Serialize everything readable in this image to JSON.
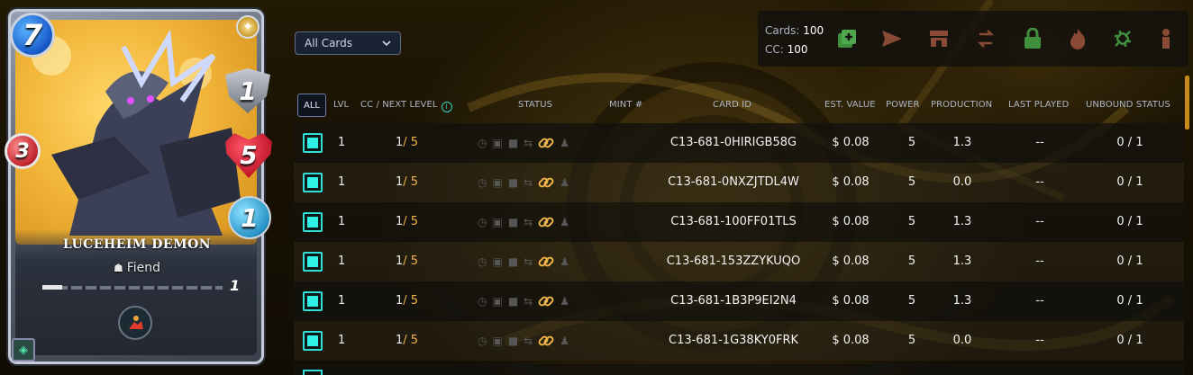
{
  "card": {
    "name": "LUCEHEIM DEMON",
    "type": "Fiend",
    "mana": "7",
    "armor": "1",
    "health": "5",
    "speed": "1",
    "melee": "3",
    "level": "1"
  },
  "filter": {
    "selected": "All Cards"
  },
  "toolbar": {
    "cards_label": "Cards:",
    "cards_value": "100",
    "cc_label": "CC:",
    "cc_value": "100",
    "icons": [
      "combine-icon",
      "send-icon",
      "market-icon",
      "transfer-icon",
      "lock-icon",
      "burn-icon",
      "unbind-icon",
      "delegate-icon"
    ],
    "icon_color_green": "#3f8f3c",
    "icon_color_muted": "#8a4b36"
  },
  "table": {
    "headers": {
      "all": "ALL",
      "lvl": "LVL",
      "cc": "CC / NEXT LEVEL",
      "status": "STATUS",
      "mint": "MINT #",
      "card_id": "CARD ID",
      "est_value": "EST. VALUE",
      "power": "POWER",
      "production": "PRODUCTION",
      "last_played": "LAST PLAYED",
      "unbound": "UNBOUND STATUS"
    },
    "rows": [
      {
        "lvl": "1",
        "cc_cur": "1",
        "cc_next": "/ 5",
        "mint": "",
        "card_id": "C13-681-0HIRIGB58G",
        "value": "$ 0.08",
        "power": "5",
        "production": "1.3",
        "last_played": "--",
        "unbound": "0 / 1"
      },
      {
        "lvl": "1",
        "cc_cur": "1",
        "cc_next": "/ 5",
        "mint": "",
        "card_id": "C13-681-0NXZJTDL4W",
        "value": "$ 0.08",
        "power": "5",
        "production": "0.0",
        "last_played": "--",
        "unbound": "0 / 1"
      },
      {
        "lvl": "1",
        "cc_cur": "1",
        "cc_next": "/ 5",
        "mint": "",
        "card_id": "C13-681-100FF01TLS",
        "value": "$ 0.08",
        "power": "5",
        "production": "1.3",
        "last_played": "--",
        "unbound": "0 / 1"
      },
      {
        "lvl": "1",
        "cc_cur": "1",
        "cc_next": "/ 5",
        "mint": "",
        "card_id": "C13-681-153ZZYKUQO",
        "value": "$ 0.08",
        "power": "5",
        "production": "1.3",
        "last_played": "--",
        "unbound": "0 / 1"
      },
      {
        "lvl": "1",
        "cc_cur": "1",
        "cc_next": "/ 5",
        "mint": "",
        "card_id": "C13-681-1B3P9EI2N4",
        "value": "$ 0.08",
        "power": "5",
        "production": "1.3",
        "last_played": "--",
        "unbound": "0 / 1"
      },
      {
        "lvl": "1",
        "cc_cur": "1",
        "cc_next": "/ 5",
        "mint": "",
        "card_id": "C13-681-1G38KY0FRK",
        "value": "$ 0.08",
        "power": "5",
        "production": "0.0",
        "last_played": "--",
        "unbound": "0 / 1"
      }
    ]
  }
}
